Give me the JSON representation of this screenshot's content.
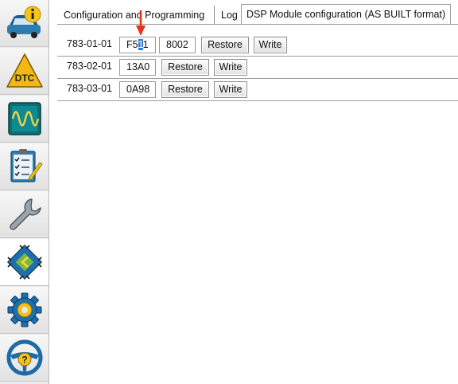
{
  "sidebar": {
    "items": [
      {
        "name": "vehicle-info-icon"
      },
      {
        "name": "dtc-icon",
        "badge_text": "DTC"
      },
      {
        "name": "oscilloscope-icon"
      },
      {
        "name": "checklist-icon"
      },
      {
        "name": "wrench-icon"
      },
      {
        "name": "module-programming-icon",
        "active": true
      },
      {
        "name": "settings-gear-icon"
      },
      {
        "name": "steering-help-icon",
        "glyph": "?"
      }
    ]
  },
  "tabs": [
    {
      "label": "Configuration and Programming"
    },
    {
      "label": "Log"
    },
    {
      "label": "DSP Module configuration (AS BUILT format)",
      "selected": true
    }
  ],
  "rows": [
    {
      "id": "783-01-01",
      "fields": [
        {
          "pre": "F5",
          "selected": "1",
          "post": "1"
        },
        {
          "value": "8002"
        }
      ],
      "restore_label": "Restore",
      "write_label": "Write"
    },
    {
      "id": "783-02-01",
      "fields": [
        {
          "value": "13A0"
        }
      ],
      "restore_label": "Restore",
      "write_label": "Write"
    },
    {
      "id": "783-03-01",
      "fields": [
        {
          "value": "0A98"
        }
      ],
      "restore_label": "Restore",
      "write_label": "Write"
    }
  ],
  "colors": {
    "selection": "#2f7fd8",
    "annotation_arrow": "#e8321c"
  }
}
